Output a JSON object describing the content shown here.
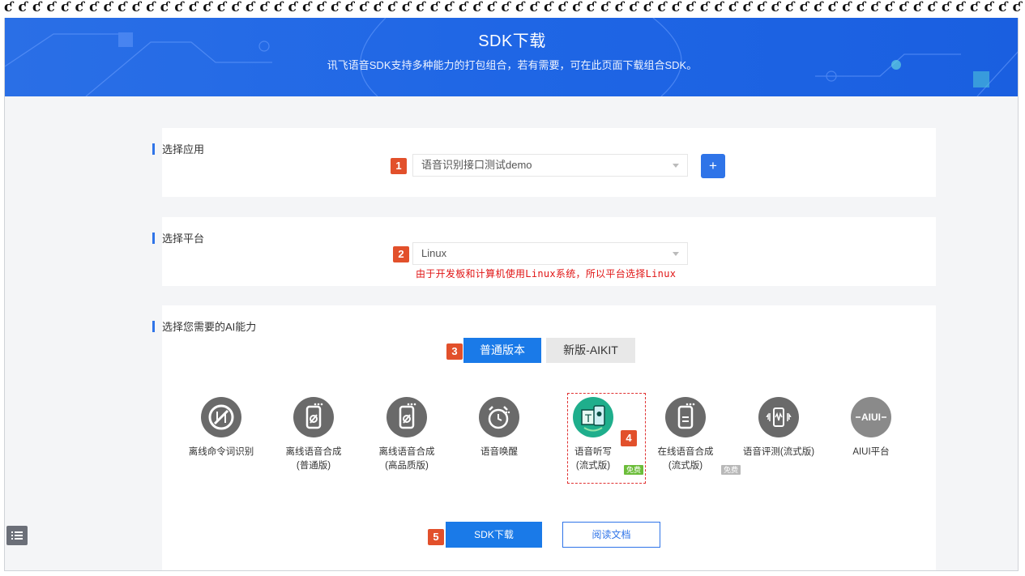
{
  "banner": {
    "title": "SDK下载",
    "subtitle": "讯飞语音SDK支持多种能力的打包组合，若有需要，可在此页面下载组合SDK。"
  },
  "app_section": {
    "heading": "选择应用",
    "step": "1",
    "selected_app": "语音识别接口测试demo",
    "add_label": "+"
  },
  "platform_section": {
    "heading": "选择平台",
    "step": "2",
    "selected_platform": "Linux",
    "annotation": "由于开发板和计算机使用Linux系统，所以平台选择Linux"
  },
  "ability_section": {
    "heading": "选择您需要的AI能力",
    "step_tab": "3",
    "tabs": [
      {
        "label": "普通版本",
        "active": true
      },
      {
        "label": "新版-AIKIT",
        "active": false
      }
    ],
    "step_selected": "4",
    "capabilities": [
      {
        "line1": "离线命令词识别",
        "line2": "",
        "icon": "offline-command-icon",
        "selected": false
      },
      {
        "line1": "离线语音合成",
        "line2": "(普通版)",
        "icon": "offline-tts-icon",
        "selected": false
      },
      {
        "line1": "离线语音合成",
        "line2": "(高品质版)",
        "icon": "offline-tts-hq-icon",
        "selected": false
      },
      {
        "line1": "语音唤醒",
        "line2": "",
        "icon": "wakeup-alarm-icon",
        "selected": false
      },
      {
        "line1": "语音听写",
        "line2": "(流式版)",
        "icon": "dictation-icon",
        "selected": true,
        "tag": "免费"
      },
      {
        "line1": "在线语音合成",
        "line2": "(流式版)",
        "icon": "online-tts-icon",
        "selected": false,
        "tag": "免费"
      },
      {
        "line1": "语音评测(流式版)",
        "line2": "",
        "icon": "speech-evaluation-icon",
        "selected": false
      },
      {
        "line1": "AIUI平台",
        "line2": "",
        "icon": "aiui-icon",
        "selected": false
      }
    ],
    "step_download": "5",
    "download_label": "SDK下载",
    "docs_label": "阅读文档"
  },
  "colors": {
    "primary": "#2f74e8",
    "banner": "#1f66e5",
    "step_badge": "#e2502b",
    "annotation_red": "#e01515",
    "free_tag": "#6cbd3a"
  }
}
